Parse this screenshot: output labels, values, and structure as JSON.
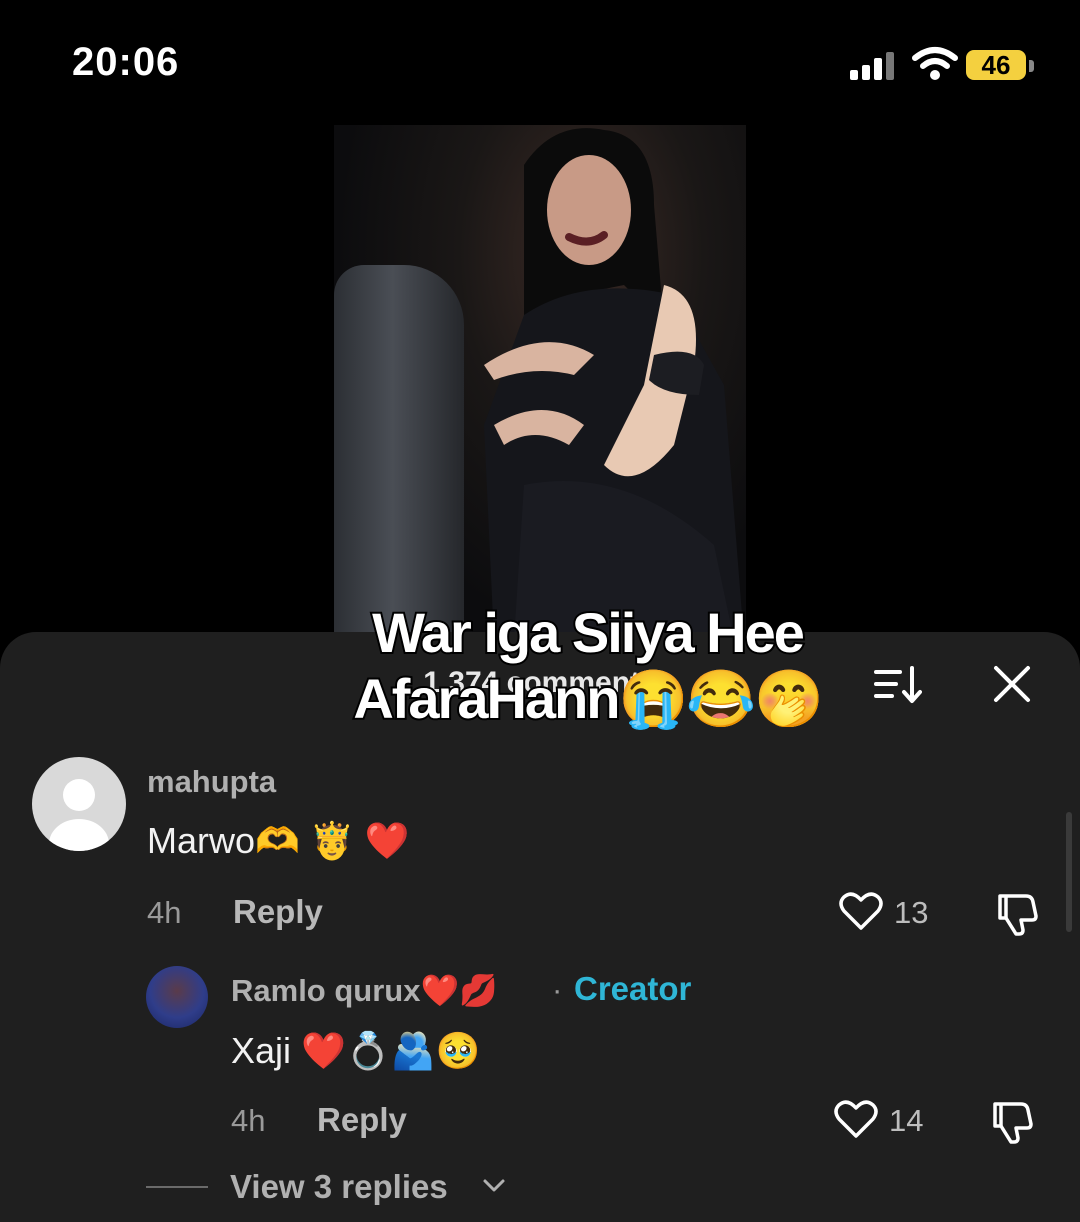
{
  "status_bar": {
    "time": "20:06",
    "battery": "46"
  },
  "video": {
    "caption_line1": "War iga Siiya Hee",
    "caption_line2": "AfaraHann😭😂🤭"
  },
  "comments_sheet": {
    "title": "1,374 comments",
    "comments": [
      {
        "username": "mahupta",
        "text": "Marwo🫶 🤴 ❤️",
        "time": "4h",
        "reply_label": "Reply",
        "likes": "13"
      },
      {
        "username": "Ramlo qurux❤️💋",
        "badge": "Creator",
        "separator": "·",
        "text": "Xaji ❤️💍🫂🥹",
        "time": "4h",
        "reply_label": "Reply",
        "likes": "14"
      }
    ],
    "view_replies": "View 3 replies"
  },
  "icons": [
    "signal-icon",
    "wifi-icon",
    "battery-icon",
    "sort-icon",
    "close-icon",
    "heart-icon",
    "dislike-icon",
    "chevron-down-icon"
  ]
}
